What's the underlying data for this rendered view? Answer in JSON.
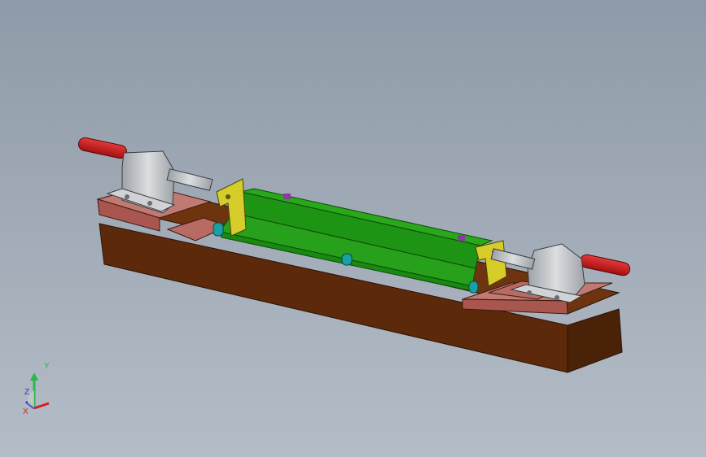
{
  "viewport": {
    "background_top": "#8f9aa8",
    "background_bottom": "#b4bdc7"
  },
  "model": {
    "base_color": "#5a2a0c",
    "pad_color": "#b86a63",
    "part_color": "#1f9a17",
    "bracket_color": "#d6cc2a",
    "handle_color": "#c81515",
    "pin_color": "#1aa0a0",
    "clamp_color": "#c7c9cc",
    "marker_color": "#8a3aa0"
  },
  "triad": {
    "y_label": "Y",
    "z_label": "Z",
    "x_label": "X",
    "y_color": "#2ab84a",
    "x_color": "#d21f1f",
    "z_color": "#2a3ac8"
  }
}
